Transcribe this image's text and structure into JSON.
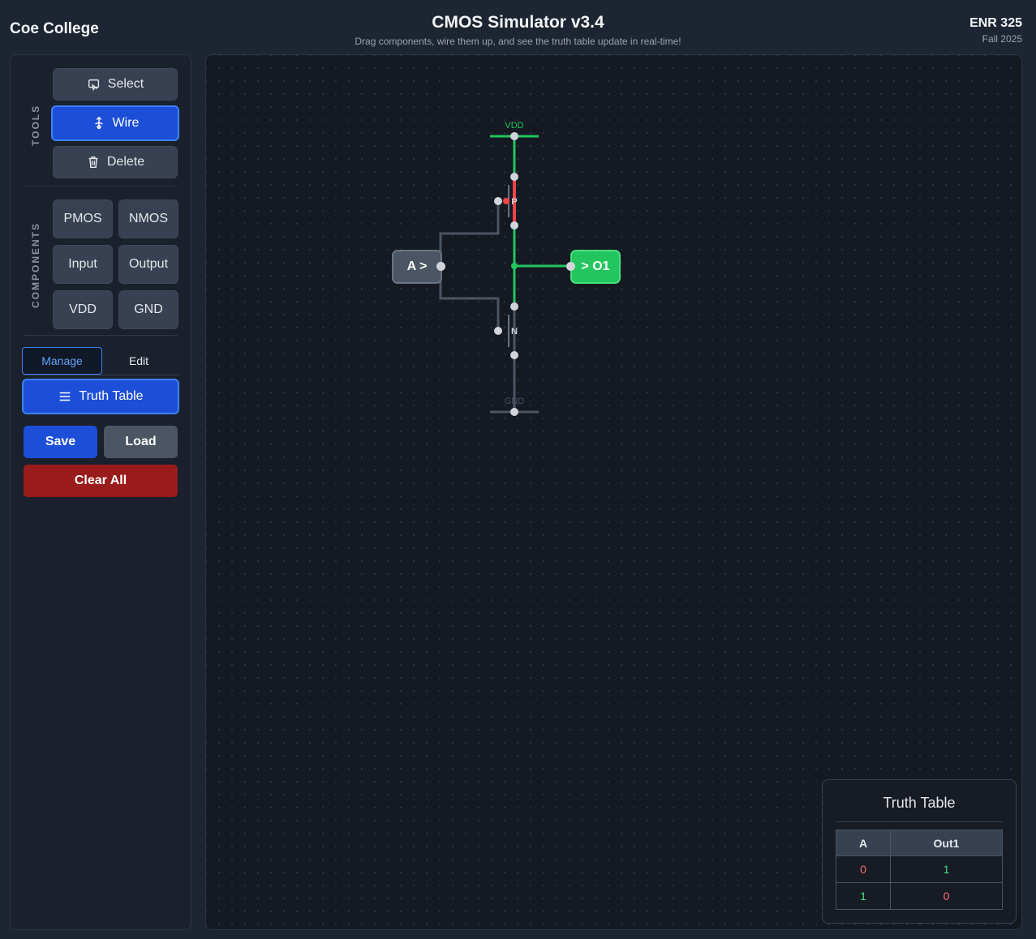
{
  "header": {
    "brand": "Coe College",
    "title": "CMOS Simulator v3.4",
    "subtitle": "Drag components, wire them up, and see the truth table update in real-time!",
    "course_code": "ENR 325",
    "term": "Fall 2025"
  },
  "sidebar": {
    "tools_label": "TOOLS",
    "tools": [
      {
        "label": "Select",
        "icon": "select-icon",
        "active": false
      },
      {
        "label": "Wire",
        "icon": "wire-icon",
        "active": true
      },
      {
        "label": "Delete",
        "icon": "trash-icon",
        "active": false
      }
    ],
    "components_label": "COMPONENTS",
    "components": [
      "PMOS",
      "NMOS",
      "Input",
      "Output",
      "VDD",
      "GND"
    ],
    "tabs": [
      {
        "label": "Manage",
        "active": true
      },
      {
        "label": "Edit",
        "active": false
      }
    ],
    "truth_table_button": "Truth Table",
    "save_label": "Save",
    "load_label": "Load",
    "clear_label": "Clear All"
  },
  "circuit": {
    "vdd_label": "VDD",
    "gnd_label": "GND",
    "pmos_label": "P",
    "nmos_label": "N",
    "input_label": "A >",
    "output_label": "> O1"
  },
  "colors": {
    "active_wire": "#22c55e",
    "inactive_wire": "#4b5563",
    "pmos_on": "#ef4444",
    "accent": "#1d4ed8",
    "danger": "#991b1b"
  },
  "truth_table": {
    "title": "Truth Table",
    "headers": [
      "A",
      "Out1"
    ],
    "rows": [
      [
        "0",
        "1"
      ],
      [
        "1",
        "0"
      ]
    ]
  }
}
